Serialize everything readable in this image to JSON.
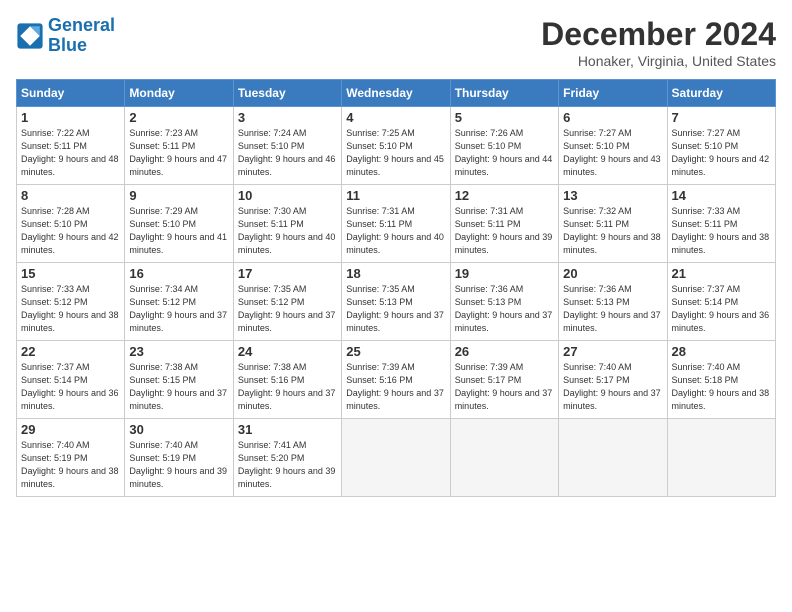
{
  "header": {
    "logo_line1": "General",
    "logo_line2": "Blue",
    "month_title": "December 2024",
    "location": "Honaker, Virginia, United States"
  },
  "days_of_week": [
    "Sunday",
    "Monday",
    "Tuesday",
    "Wednesday",
    "Thursday",
    "Friday",
    "Saturday"
  ],
  "weeks": [
    [
      {
        "num": "1",
        "sunrise": "Sunrise: 7:22 AM",
        "sunset": "Sunset: 5:11 PM",
        "daylight": "Daylight: 9 hours and 48 minutes."
      },
      {
        "num": "2",
        "sunrise": "Sunrise: 7:23 AM",
        "sunset": "Sunset: 5:11 PM",
        "daylight": "Daylight: 9 hours and 47 minutes."
      },
      {
        "num": "3",
        "sunrise": "Sunrise: 7:24 AM",
        "sunset": "Sunset: 5:10 PM",
        "daylight": "Daylight: 9 hours and 46 minutes."
      },
      {
        "num": "4",
        "sunrise": "Sunrise: 7:25 AM",
        "sunset": "Sunset: 5:10 PM",
        "daylight": "Daylight: 9 hours and 45 minutes."
      },
      {
        "num": "5",
        "sunrise": "Sunrise: 7:26 AM",
        "sunset": "Sunset: 5:10 PM",
        "daylight": "Daylight: 9 hours and 44 minutes."
      },
      {
        "num": "6",
        "sunrise": "Sunrise: 7:27 AM",
        "sunset": "Sunset: 5:10 PM",
        "daylight": "Daylight: 9 hours and 43 minutes."
      },
      {
        "num": "7",
        "sunrise": "Sunrise: 7:27 AM",
        "sunset": "Sunset: 5:10 PM",
        "daylight": "Daylight: 9 hours and 42 minutes."
      }
    ],
    [
      {
        "num": "8",
        "sunrise": "Sunrise: 7:28 AM",
        "sunset": "Sunset: 5:10 PM",
        "daylight": "Daylight: 9 hours and 42 minutes."
      },
      {
        "num": "9",
        "sunrise": "Sunrise: 7:29 AM",
        "sunset": "Sunset: 5:10 PM",
        "daylight": "Daylight: 9 hours and 41 minutes."
      },
      {
        "num": "10",
        "sunrise": "Sunrise: 7:30 AM",
        "sunset": "Sunset: 5:11 PM",
        "daylight": "Daylight: 9 hours and 40 minutes."
      },
      {
        "num": "11",
        "sunrise": "Sunrise: 7:31 AM",
        "sunset": "Sunset: 5:11 PM",
        "daylight": "Daylight: 9 hours and 40 minutes."
      },
      {
        "num": "12",
        "sunrise": "Sunrise: 7:31 AM",
        "sunset": "Sunset: 5:11 PM",
        "daylight": "Daylight: 9 hours and 39 minutes."
      },
      {
        "num": "13",
        "sunrise": "Sunrise: 7:32 AM",
        "sunset": "Sunset: 5:11 PM",
        "daylight": "Daylight: 9 hours and 38 minutes."
      },
      {
        "num": "14",
        "sunrise": "Sunrise: 7:33 AM",
        "sunset": "Sunset: 5:11 PM",
        "daylight": "Daylight: 9 hours and 38 minutes."
      }
    ],
    [
      {
        "num": "15",
        "sunrise": "Sunrise: 7:33 AM",
        "sunset": "Sunset: 5:12 PM",
        "daylight": "Daylight: 9 hours and 38 minutes."
      },
      {
        "num": "16",
        "sunrise": "Sunrise: 7:34 AM",
        "sunset": "Sunset: 5:12 PM",
        "daylight": "Daylight: 9 hours and 37 minutes."
      },
      {
        "num": "17",
        "sunrise": "Sunrise: 7:35 AM",
        "sunset": "Sunset: 5:12 PM",
        "daylight": "Daylight: 9 hours and 37 minutes."
      },
      {
        "num": "18",
        "sunrise": "Sunrise: 7:35 AM",
        "sunset": "Sunset: 5:13 PM",
        "daylight": "Daylight: 9 hours and 37 minutes."
      },
      {
        "num": "19",
        "sunrise": "Sunrise: 7:36 AM",
        "sunset": "Sunset: 5:13 PM",
        "daylight": "Daylight: 9 hours and 37 minutes."
      },
      {
        "num": "20",
        "sunrise": "Sunrise: 7:36 AM",
        "sunset": "Sunset: 5:13 PM",
        "daylight": "Daylight: 9 hours and 37 minutes."
      },
      {
        "num": "21",
        "sunrise": "Sunrise: 7:37 AM",
        "sunset": "Sunset: 5:14 PM",
        "daylight": "Daylight: 9 hours and 36 minutes."
      }
    ],
    [
      {
        "num": "22",
        "sunrise": "Sunrise: 7:37 AM",
        "sunset": "Sunset: 5:14 PM",
        "daylight": "Daylight: 9 hours and 36 minutes."
      },
      {
        "num": "23",
        "sunrise": "Sunrise: 7:38 AM",
        "sunset": "Sunset: 5:15 PM",
        "daylight": "Daylight: 9 hours and 37 minutes."
      },
      {
        "num": "24",
        "sunrise": "Sunrise: 7:38 AM",
        "sunset": "Sunset: 5:16 PM",
        "daylight": "Daylight: 9 hours and 37 minutes."
      },
      {
        "num": "25",
        "sunrise": "Sunrise: 7:39 AM",
        "sunset": "Sunset: 5:16 PM",
        "daylight": "Daylight: 9 hours and 37 minutes."
      },
      {
        "num": "26",
        "sunrise": "Sunrise: 7:39 AM",
        "sunset": "Sunset: 5:17 PM",
        "daylight": "Daylight: 9 hours and 37 minutes."
      },
      {
        "num": "27",
        "sunrise": "Sunrise: 7:40 AM",
        "sunset": "Sunset: 5:17 PM",
        "daylight": "Daylight: 9 hours and 37 minutes."
      },
      {
        "num": "28",
        "sunrise": "Sunrise: 7:40 AM",
        "sunset": "Sunset: 5:18 PM",
        "daylight": "Daylight: 9 hours and 38 minutes."
      }
    ],
    [
      {
        "num": "29",
        "sunrise": "Sunrise: 7:40 AM",
        "sunset": "Sunset: 5:19 PM",
        "daylight": "Daylight: 9 hours and 38 minutes."
      },
      {
        "num": "30",
        "sunrise": "Sunrise: 7:40 AM",
        "sunset": "Sunset: 5:19 PM",
        "daylight": "Daylight: 9 hours and 39 minutes."
      },
      {
        "num": "31",
        "sunrise": "Sunrise: 7:41 AM",
        "sunset": "Sunset: 5:20 PM",
        "daylight": "Daylight: 9 hours and 39 minutes."
      },
      null,
      null,
      null,
      null
    ]
  ]
}
